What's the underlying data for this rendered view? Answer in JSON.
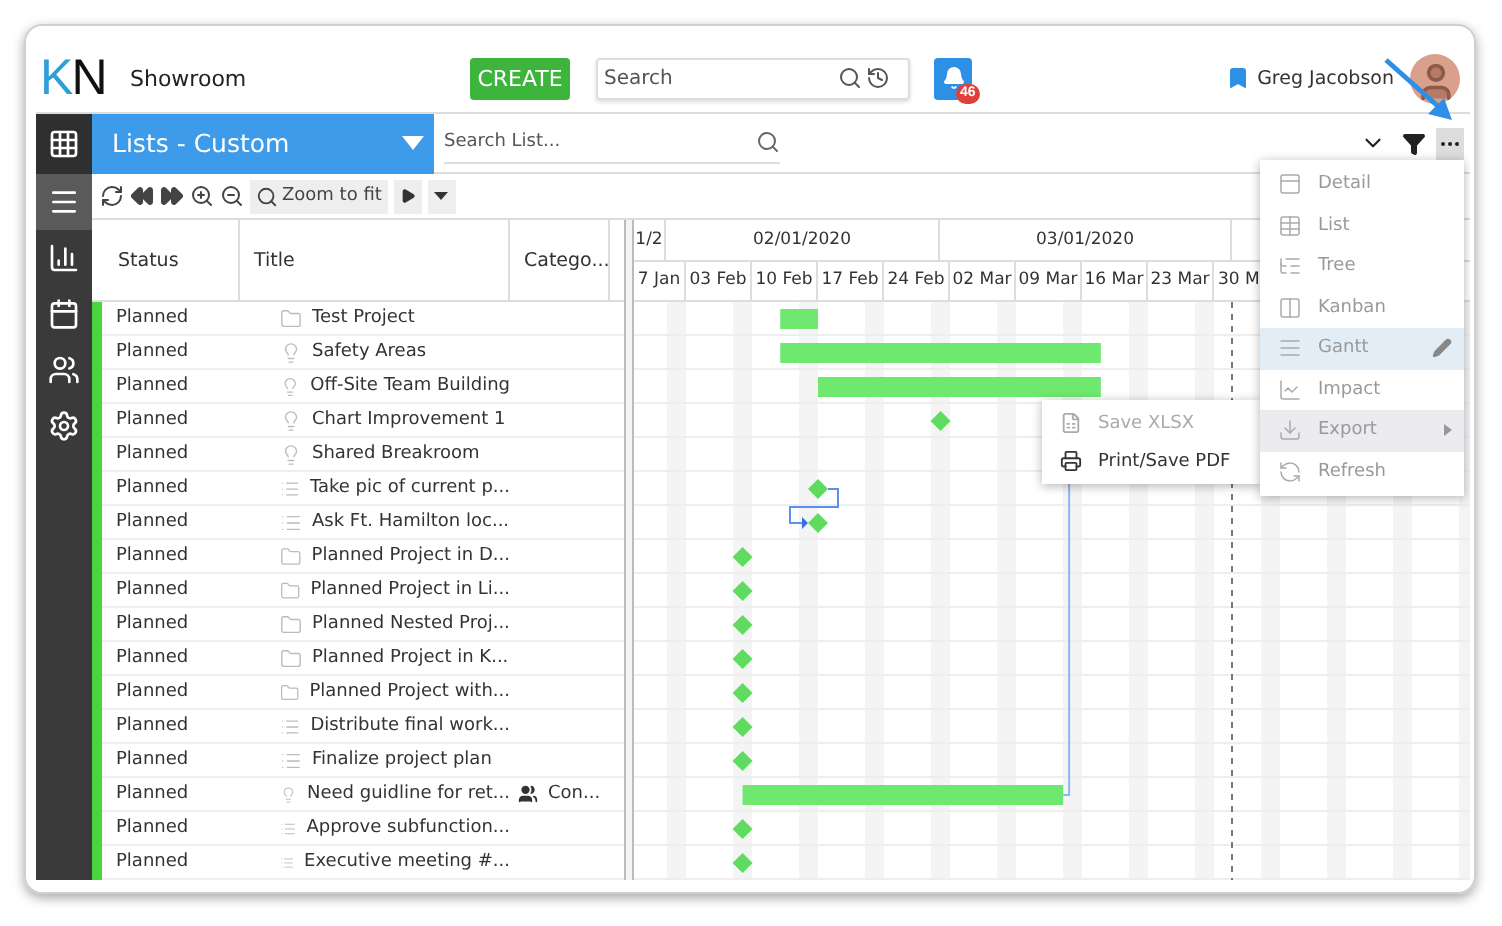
{
  "header": {
    "logo": "KN",
    "workspace": "Showroom",
    "create_button": "CREATE",
    "search": {
      "placeholder": "Search"
    },
    "notifications": {
      "count": "46"
    },
    "user": {
      "name": "Greg Jacobson"
    }
  },
  "list_bar": {
    "title": "Lists - Custom",
    "search": {
      "placeholder": "Search List..."
    }
  },
  "sidebar": {
    "items": [
      {
        "selected": true
      },
      {
        "selected": false
      },
      {
        "selected": false
      },
      {
        "selected": false
      },
      {
        "selected": false
      }
    ]
  },
  "toolbar": {
    "zoom_to_fit": "Zoom to fit"
  },
  "table": {
    "columns": [
      "Status",
      "Title",
      "Catego..."
    ],
    "rows": [
      {
        "status": "Planned",
        "color": "#4cd43f",
        "kind": "project",
        "title": "Test Project",
        "task": {
          "kind": "bar"
        }
      },
      {
        "status": "Planned",
        "color": "#4cd43f",
        "kind": "idea",
        "title": "Safety Areas",
        "task": {
          "kind": "bar"
        }
      },
      {
        "status": "Planned",
        "color": "#4cd43f",
        "kind": "idea",
        "title": "Off-Site Team Building",
        "task": {
          "kind": "bar"
        }
      },
      {
        "status": "Planned",
        "color": "#4cd43f",
        "kind": "idea",
        "title": "Chart Improvement 1",
        "task": {
          "kind": "milestone"
        }
      },
      {
        "status": "Planned",
        "color": "#4cd43f",
        "kind": "idea",
        "title": "Shared Breakroom"
      },
      {
        "status": "Planned",
        "color": "#4cd43f",
        "kind": "task",
        "title": "Take pic of current p...",
        "task": {
          "kind": "milestone"
        }
      },
      {
        "status": "Planned",
        "color": "#4cd43f",
        "kind": "task",
        "title": "Ask Ft. Hamilton loc...",
        "task": {
          "kind": "milestone"
        }
      },
      {
        "status": "Planned",
        "color": "#4cd43f",
        "kind": "project",
        "title": "Planned Project in D...",
        "task": {
          "kind": "milestone"
        }
      },
      {
        "status": "Planned",
        "color": "#4cd43f",
        "kind": "project",
        "title": "Planned Project in Li...",
        "task": {
          "kind": "milestone"
        }
      },
      {
        "status": "Planned",
        "color": "#4cd43f",
        "kind": "project",
        "title": "Planned Nested Proj...",
        "task": {
          "kind": "milestone"
        }
      },
      {
        "status": "Planned",
        "color": "#4cd43f",
        "kind": "project",
        "title": "Planned Project in K...",
        "task": {
          "kind": "milestone"
        }
      },
      {
        "status": "Planned",
        "color": "#4cd43f",
        "kind": "project",
        "title": "Planned Project with...",
        "task": {
          "kind": "milestone"
        }
      },
      {
        "status": "Planned",
        "color": "#4cd43f",
        "kind": "task",
        "title": "Distribute final work...",
        "task": {
          "kind": "milestone"
        }
      },
      {
        "status": "Planned",
        "color": "#4cd43f",
        "kind": "task",
        "title": "Finalize project plan",
        "task": {
          "kind": "milestone"
        }
      },
      {
        "status": "Planned",
        "color": "#4cd43f",
        "kind": "idea",
        "title": "Need guidline for ret...",
        "category": "Con...",
        "task": {
          "kind": "bar"
        }
      },
      {
        "status": "Planned",
        "color": "#4cd43f",
        "kind": "task",
        "title": "Approve subfunction...",
        "task": {
          "kind": "milestone"
        }
      },
      {
        "status": "Planned",
        "color": "#4cd43f",
        "kind": "task",
        "title": "Executive meeting #...",
        "task": {
          "kind": "milestone"
        }
      }
    ]
  },
  "gantt": {
    "months": [
      "1/2",
      "02/01/2020",
      "03/01/2020"
    ],
    "weeks": [
      "7 Jan",
      "03 Feb",
      "10 Feb",
      "17 Feb",
      "24 Feb",
      "02 Mar",
      "09 Mar",
      "16 Mar",
      "23 Mar",
      "30 M"
    ]
  },
  "menu": {
    "items": [
      {
        "label": "Detail",
        "selected": false,
        "expanded": false
      },
      {
        "label": "List",
        "selected": false,
        "expanded": false
      },
      {
        "label": "Tree",
        "selected": false,
        "expanded": false
      },
      {
        "label": "Kanban",
        "selected": false,
        "expanded": false
      },
      {
        "label": "Gantt",
        "selected": true,
        "expanded": false
      },
      {
        "label": "Impact",
        "selected": false,
        "expanded": false
      },
      {
        "label": "Export",
        "selected": false,
        "expanded": true,
        "submenu": [
          {
            "label": "Save XLSX",
            "disabled": true
          },
          {
            "label": "Print/Save PDF",
            "disabled": false
          }
        ]
      },
      {
        "label": "Refresh",
        "selected": false,
        "expanded": false
      }
    ]
  }
}
